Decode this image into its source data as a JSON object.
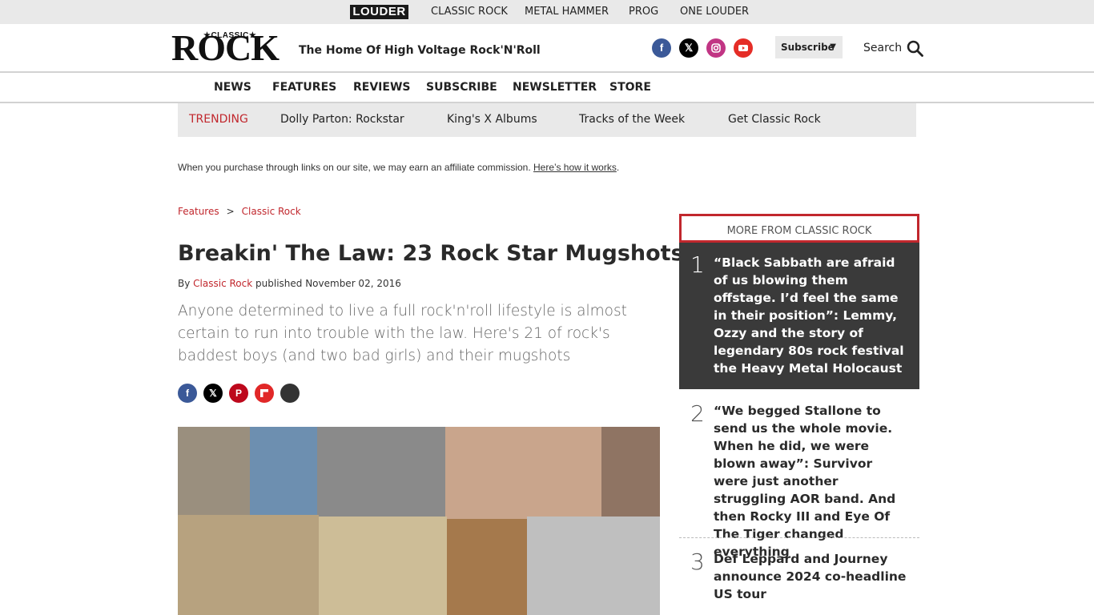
{
  "network": {
    "logo": "LOUDER",
    "links": [
      "CLASSIC ROCK",
      "METAL HAMMER",
      "PROG",
      "ONE LOUDER"
    ]
  },
  "header": {
    "logo_small": "★CLASSIC★",
    "logo_big": "ROCK",
    "tagline": "The Home Of High Voltage Rock'N'Roll",
    "social_icons": [
      "facebook-icon",
      "x-icon",
      "instagram-icon",
      "youtube-icon"
    ],
    "subscribe_label": "Subscribe",
    "search_label": "Search"
  },
  "nav": [
    "NEWS",
    "FEATURES",
    "REVIEWS",
    "SUBSCRIBE",
    "NEWSLETTER",
    "STORE"
  ],
  "trending": {
    "label": "TRENDING",
    "items": [
      "Dolly Parton: Rockstar",
      "King's X Albums",
      "Tracks of the Week",
      "Get Classic Rock"
    ]
  },
  "affiliate": {
    "text": "When you purchase through links on our site, we may earn an affiliate commission.",
    "link": "Here’s how it works",
    "period": "."
  },
  "breadcrumb": {
    "items": [
      "Features",
      "Classic Rock"
    ],
    "separator": ">"
  },
  "article": {
    "title": "Breakin' The Law: 23 Rock Star Mugshots",
    "by": "By",
    "author": "Classic Rock",
    "published": "published November 02, 2016",
    "standfirst": "Anyone determined to live a full rock'n'roll lifestyle is almost certain to run into trouble with the law. Here's 21 of rock's baddest boys (and two bad girls) and their mugshots",
    "share_icons": [
      "facebook-icon",
      "x-icon",
      "pinterest-icon",
      "flipboard-icon",
      "email-icon"
    ]
  },
  "sidebar": {
    "heading": "MORE FROM CLASSIC ROCK",
    "items": [
      {
        "rank": "1",
        "title": "“Black Sabbath are afraid of us blowing them offstage. I’d feel the same in their position”: Lemmy, Ozzy and the story of legendary 80s rock festival the Heavy Metal Holocaust"
      },
      {
        "rank": "2",
        "title": "“We begged Stallone to send us the whole movie. When he did, we were blown away”: Survivor were just another struggling AOR band. And then Rocky III and Eye Of The Tiger changed everything"
      },
      {
        "rank": "3",
        "title": "Def Leppard and Journey announce 2024 co-headline US tour"
      }
    ]
  },
  "colors": {
    "accent": "#c1272d",
    "bar_bg": "#e9e9e9",
    "feature_bg": "#3a3a3a",
    "facebook": "#3b5998",
    "x": "#000000",
    "instagram": "#c13584",
    "youtube": "#e52d27",
    "pinterest": "#bd081c",
    "flipboard": "#e12828"
  }
}
